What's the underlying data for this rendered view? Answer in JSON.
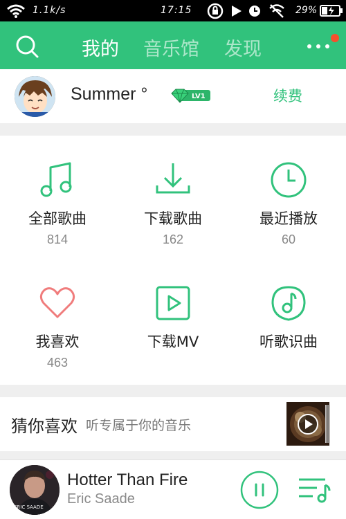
{
  "status_bar": {
    "net_speed": "1.1k/s",
    "time": "17:15",
    "battery": "29%"
  },
  "header": {
    "tabs": [
      {
        "label": "我的"
      },
      {
        "label": "音乐馆"
      },
      {
        "label": "发现"
      }
    ],
    "active_tab": "我的"
  },
  "profile": {
    "username": "Summer °",
    "level_badge": "LV1",
    "renew_label": "续费"
  },
  "grid": {
    "items": [
      {
        "label": "全部歌曲",
        "count": "814",
        "icon": "music-note-icon"
      },
      {
        "label": "下载歌曲",
        "count": "162",
        "icon": "download-icon"
      },
      {
        "label": "最近播放",
        "count": "60",
        "icon": "clock-icon"
      },
      {
        "label": "我喜欢",
        "count": "463",
        "icon": "heart-icon"
      },
      {
        "label": "下载MV",
        "icon": "video-play-icon"
      },
      {
        "label": "听歌识曲",
        "icon": "music-recognize-icon"
      }
    ]
  },
  "guess": {
    "title": "猜你喜欢",
    "subtitle": "听专属于你的音乐"
  },
  "player": {
    "song_title": "Hotter Than Fire",
    "artist": "Eric Saade",
    "art_text": "ERIC SAADE"
  },
  "colors": {
    "accent": "#31c27c",
    "heart": "#f07c7c",
    "notification_dot": "#f6502c"
  }
}
